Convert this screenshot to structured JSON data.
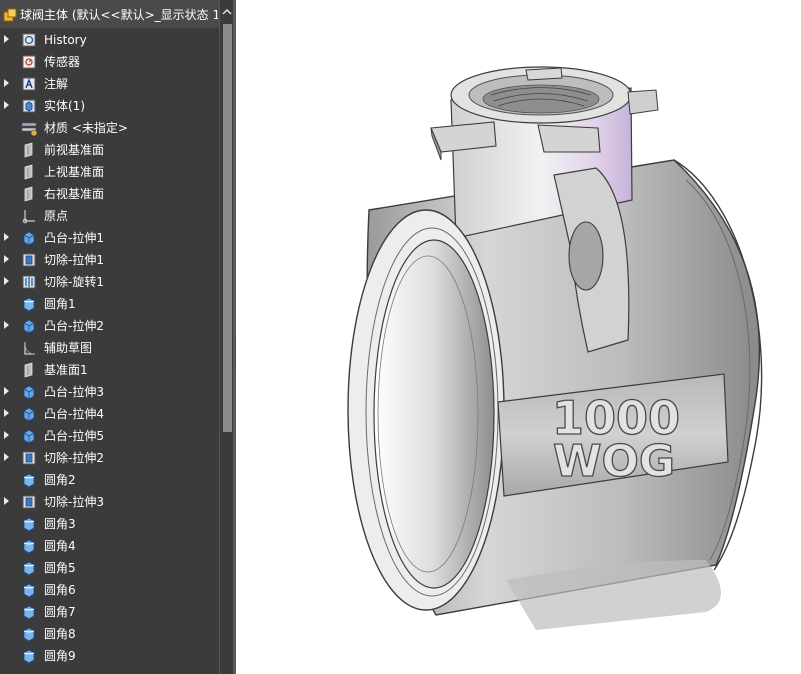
{
  "feature_tree": {
    "root_label": "球阀主体 (默认<<默认>_显示状态 1",
    "items": [
      {
        "label": "History",
        "expandable": true,
        "icon": "history-icon"
      },
      {
        "label": "传感器",
        "expandable": false,
        "icon": "sensor-icon"
      },
      {
        "label": "注解",
        "expandable": true,
        "icon": "annotation-icon"
      },
      {
        "label": "实体(1)",
        "expandable": true,
        "icon": "solid-bodies-icon"
      },
      {
        "label": "材质 <未指定>",
        "expandable": false,
        "icon": "material-icon"
      },
      {
        "label": "前视基准面",
        "expandable": false,
        "icon": "plane-icon"
      },
      {
        "label": "上视基准面",
        "expandable": false,
        "icon": "plane-icon"
      },
      {
        "label": "右视基准面",
        "expandable": false,
        "icon": "plane-icon"
      },
      {
        "label": "原点",
        "expandable": false,
        "icon": "origin-icon"
      },
      {
        "label": "凸台-拉伸1",
        "expandable": true,
        "icon": "boss-extrude-icon"
      },
      {
        "label": "切除-拉伸1",
        "expandable": true,
        "icon": "cut-extrude-icon"
      },
      {
        "label": "切除-旋转1",
        "expandable": true,
        "icon": "cut-revolve-icon"
      },
      {
        "label": "圆角1",
        "expandable": false,
        "icon": "fillet-icon"
      },
      {
        "label": "凸台-拉伸2",
        "expandable": true,
        "icon": "boss-extrude-icon"
      },
      {
        "label": "辅助草图",
        "expandable": false,
        "icon": "sketch-icon"
      },
      {
        "label": "基准面1",
        "expandable": false,
        "icon": "plane-icon"
      },
      {
        "label": "凸台-拉伸3",
        "expandable": true,
        "icon": "boss-extrude-icon"
      },
      {
        "label": "凸台-拉伸4",
        "expandable": true,
        "icon": "boss-extrude-icon"
      },
      {
        "label": "凸台-拉伸5",
        "expandable": true,
        "icon": "boss-extrude-icon"
      },
      {
        "label": "切除-拉伸2",
        "expandable": true,
        "icon": "cut-extrude-icon"
      },
      {
        "label": "圆角2",
        "expandable": false,
        "icon": "fillet-icon"
      },
      {
        "label": "切除-拉伸3",
        "expandable": true,
        "icon": "cut-extrude-icon"
      },
      {
        "label": "圆角3",
        "expandable": false,
        "icon": "fillet-icon"
      },
      {
        "label": "圆角4",
        "expandable": false,
        "icon": "fillet-icon"
      },
      {
        "label": "圆角5",
        "expandable": false,
        "icon": "fillet-icon"
      },
      {
        "label": "圆角6",
        "expandable": false,
        "icon": "fillet-icon"
      },
      {
        "label": "圆角7",
        "expandable": false,
        "icon": "fillet-icon"
      },
      {
        "label": "圆角8",
        "expandable": false,
        "icon": "fillet-icon"
      },
      {
        "label": "圆角9",
        "expandable": false,
        "icon": "fillet-icon"
      }
    ]
  },
  "viewport": {
    "embossed_line1": "1000",
    "embossed_line2": "WOG"
  },
  "colors": {
    "panel_bg": "#3b3b3b",
    "tree_text": "#ffffff",
    "model_gray": "#c8c8c8",
    "model_highlight": "#d8c8e6"
  }
}
